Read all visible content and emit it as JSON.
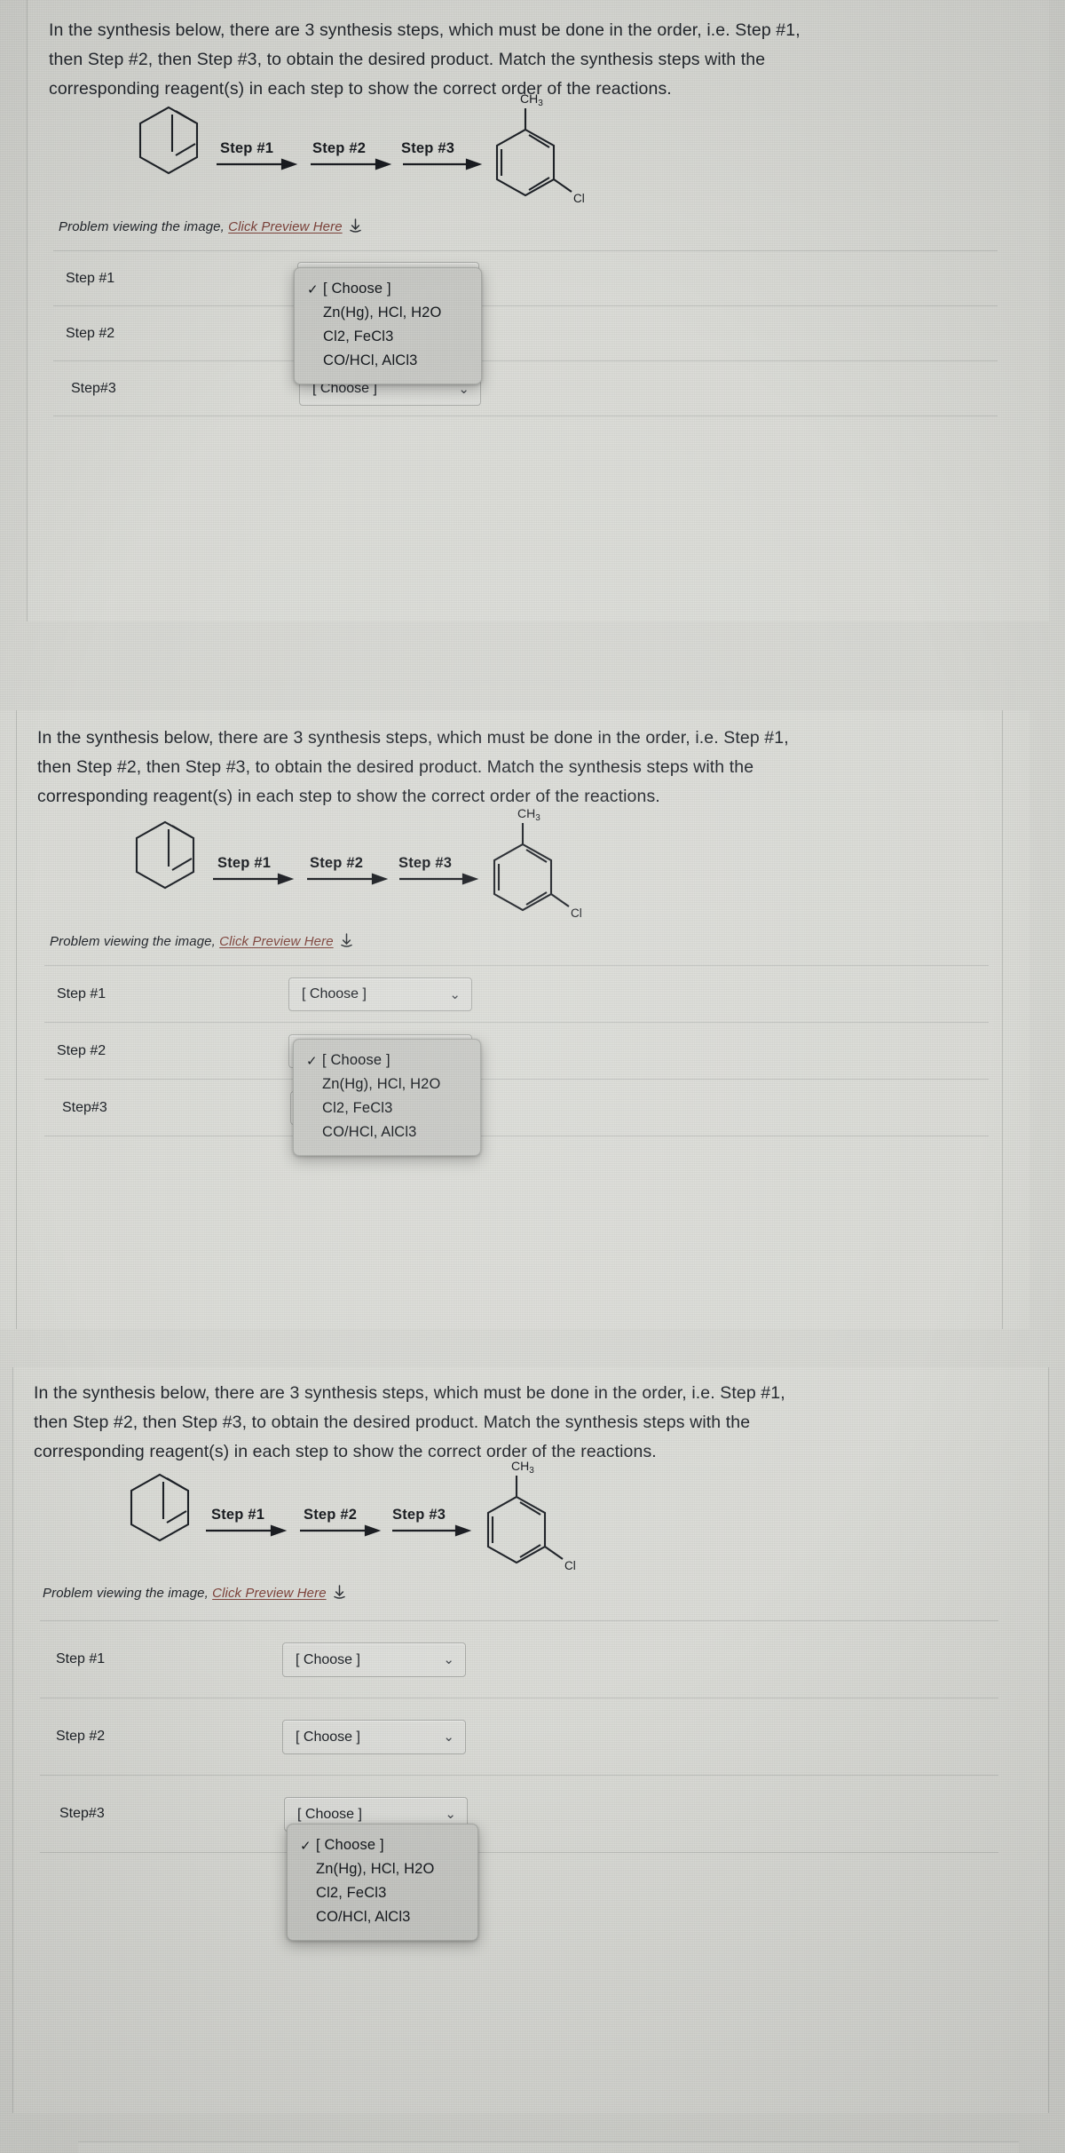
{
  "question": {
    "text": "In the synthesis below, there are 3 synthesis steps, which must be done in the order, i.e. Step #1,\nthen Step #2, then Step #3, to obtain the desired product. Match the synthesis steps with the\ncorresponding reagent(s) in each step to show the correct order of the reactions."
  },
  "scheme": {
    "reactant_name": "benzene",
    "product_name": "chlorotoluene",
    "product_substituent_top": "CH3",
    "product_substituent_right": "Cl",
    "arrow_labels": [
      "Step #1",
      "Step #2",
      "Step #3"
    ]
  },
  "problem_line": {
    "prefix": "Problem viewing the image,",
    "link": "Click Preview Here",
    "icon": "download-arrow-icon"
  },
  "match_rows": [
    {
      "label": "Step #1",
      "value": "[ Choose ]"
    },
    {
      "label": "Step #2",
      "value": "[ Choose ]"
    },
    {
      "label": "Step#3",
      "value": "[ Choose ]"
    }
  ],
  "dropdown": {
    "options": [
      "[ Choose ]",
      "Zn(Hg), HCl, H2O",
      "Cl2, FeCl3",
      "CO/HCl, AlCl3"
    ],
    "selected": "[ Choose ]",
    "checkmark": "✓"
  },
  "panels": [
    {
      "id": "panel-1",
      "open_row_index": 0
    },
    {
      "id": "panel-2",
      "open_row_index": 1
    },
    {
      "id": "panel-3",
      "open_row_index": 2
    }
  ],
  "colors": {
    "screen_background": "#b9bbb9",
    "sheet_background": "#dcddd8",
    "text": "#20242a",
    "link": "#7d4038",
    "rule": "#c2c4c0",
    "select_border": "#adafab",
    "popup_background": "#c9cac6"
  },
  "icons": {
    "chevron_down": "⌄"
  }
}
